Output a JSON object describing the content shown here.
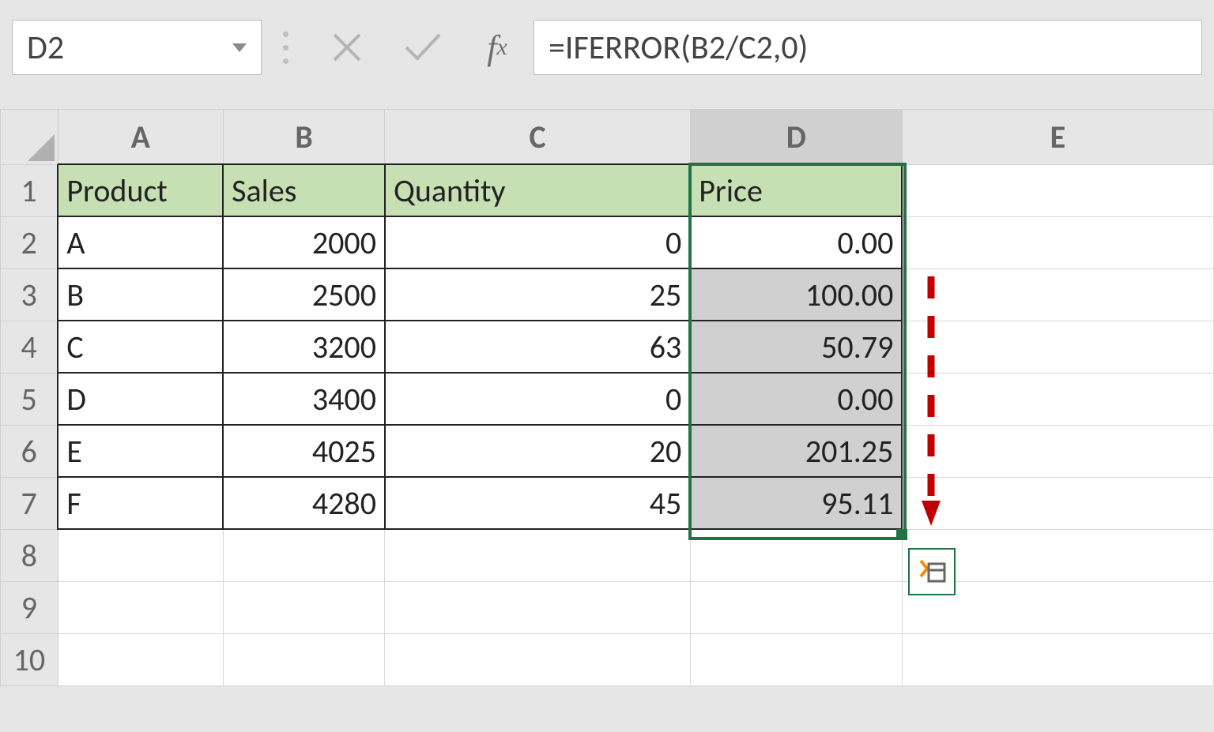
{
  "namebox": {
    "value": "D2"
  },
  "formula": {
    "value": "=IFERROR(B2/C2,0)"
  },
  "columns": [
    "A",
    "B",
    "C",
    "D",
    "E"
  ],
  "rows": [
    "1",
    "2",
    "3",
    "4",
    "5",
    "6",
    "7",
    "8",
    "9",
    "10"
  ],
  "headers": {
    "A": "Product",
    "B": "Sales",
    "C": "Quantity",
    "D": "Price"
  },
  "data": [
    {
      "A": "A",
      "B": "2000",
      "C": "0",
      "D": "0.00"
    },
    {
      "A": "B",
      "B": "2500",
      "C": "25",
      "D": "100.00"
    },
    {
      "A": "C",
      "B": "3200",
      "C": "63",
      "D": "50.79"
    },
    {
      "A": "D",
      "B": "3400",
      "C": "0",
      "D": "0.00"
    },
    {
      "A": "E",
      "B": "4025",
      "C": "20",
      "D": "201.25"
    },
    {
      "A": "F",
      "B": "4280",
      "C": "45",
      "D": "95.11"
    }
  ],
  "selected_column": "D",
  "selection_range": "D2:D7"
}
